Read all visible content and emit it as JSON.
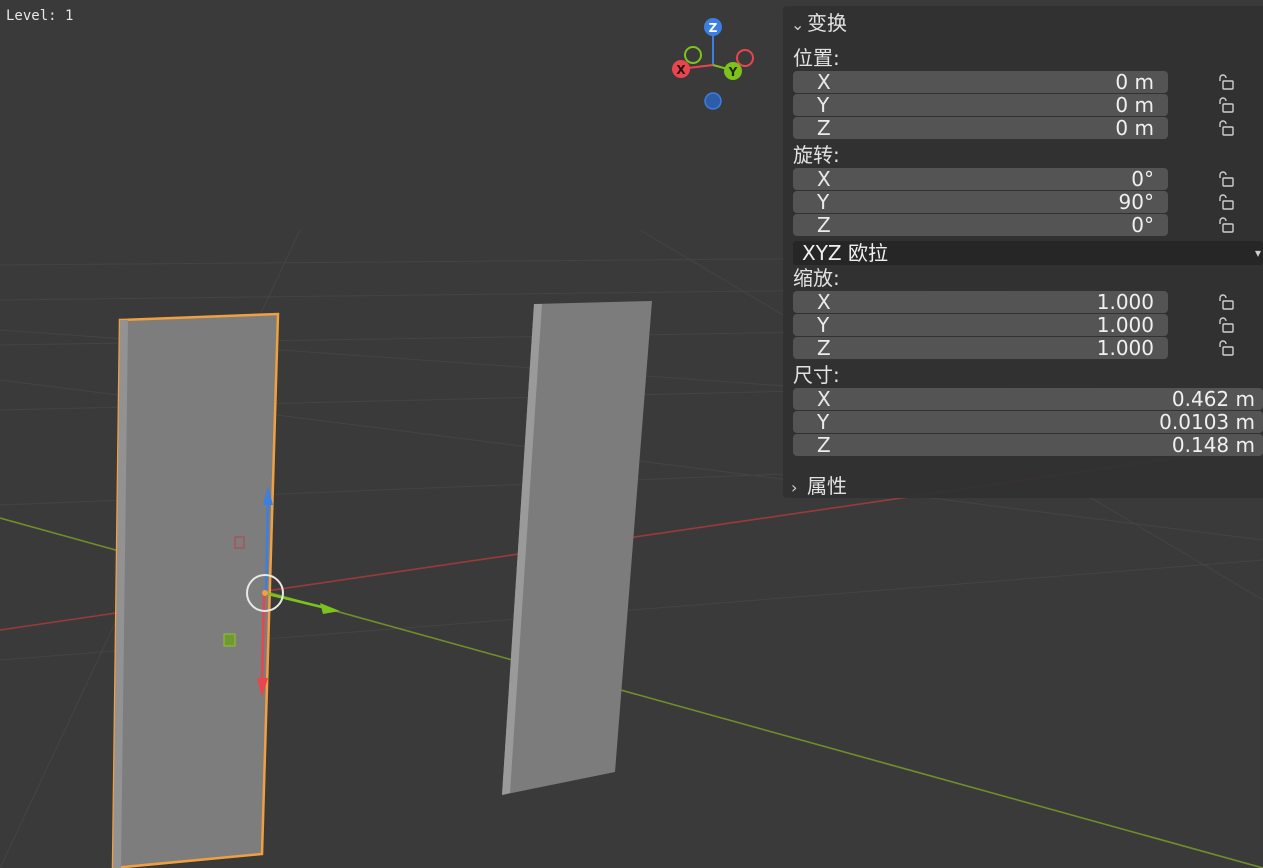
{
  "viewport": {
    "overlay_text": "Level: 1",
    "gizmo_axes": [
      "Z",
      "X",
      "Y"
    ],
    "colors": {
      "background": "#3a3a3a",
      "selected_outline": "#f0a040",
      "x_axis": "#e8454f",
      "y_axis": "#7ec21e",
      "z_axis": "#3b7fe0"
    }
  },
  "panel": {
    "transform_title": "变换",
    "location": {
      "label": "位置:",
      "rows": [
        {
          "axis": "X",
          "value": "0 m"
        },
        {
          "axis": "Y",
          "value": "0 m"
        },
        {
          "axis": "Z",
          "value": "0 m"
        }
      ]
    },
    "rotation": {
      "label": "旋转:",
      "rows": [
        {
          "axis": "X",
          "value": "0°"
        },
        {
          "axis": "Y",
          "value": "90°"
        },
        {
          "axis": "Z",
          "value": "0°"
        }
      ],
      "mode": "XYZ 欧拉"
    },
    "scale": {
      "label": "缩放:",
      "rows": [
        {
          "axis": "X",
          "value": "1.000"
        },
        {
          "axis": "Y",
          "value": "1.000"
        },
        {
          "axis": "Z",
          "value": "1.000"
        }
      ]
    },
    "dimensions": {
      "label": "尺寸:",
      "rows": [
        {
          "axis": "X",
          "value": "0.462 m"
        },
        {
          "axis": "Y",
          "value": "0.0103 m"
        },
        {
          "axis": "Z",
          "value": "0.148 m"
        }
      ]
    },
    "properties_title": "属性"
  }
}
